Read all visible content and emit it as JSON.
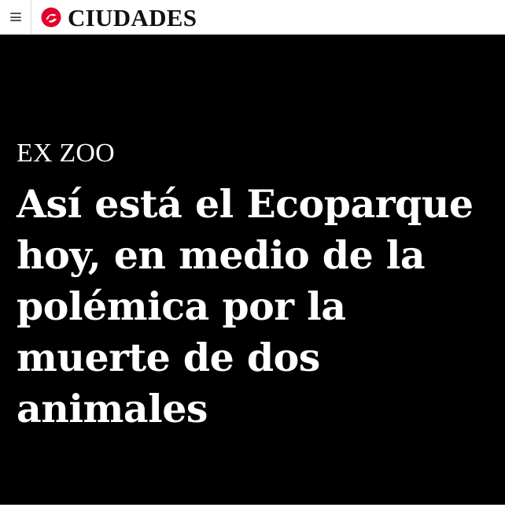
{
  "header": {
    "menu_icon": "hamburger-menu-icon",
    "logo_icon": "clarin-logo-icon",
    "brand_color": "#e4002b",
    "section_title": "CIUDADES"
  },
  "hero": {
    "background": "#000000",
    "kicker": "EX ZOO",
    "headline": "Así está el Ecoparque hoy, en medio de la polémica por la muerte de dos animales"
  }
}
